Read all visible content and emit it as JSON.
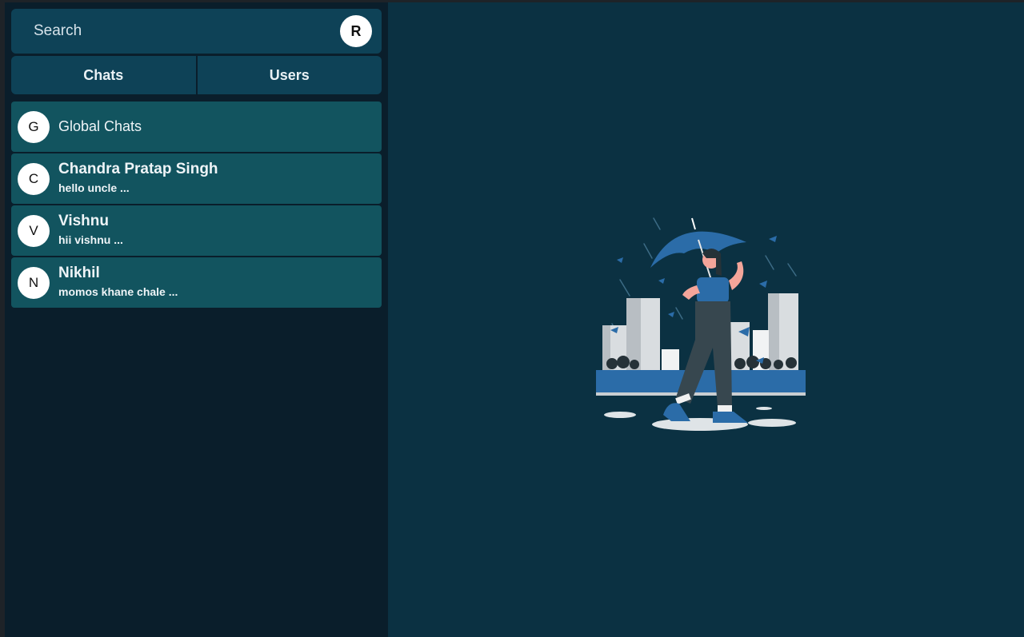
{
  "search": {
    "placeholder": "Search"
  },
  "profile": {
    "initial": "R"
  },
  "tabs": [
    {
      "label": "Chats"
    },
    {
      "label": "Users"
    }
  ],
  "chats": [
    {
      "initial": "G",
      "name": "Global Chats",
      "preview": ""
    },
    {
      "initial": "C",
      "name": "Chandra Pratap Singh",
      "preview": "hello uncle ..."
    },
    {
      "initial": "V",
      "name": "Vishnu",
      "preview": "hii vishnu ..."
    },
    {
      "initial": "N",
      "name": "Nikhil",
      "preview": "momos khane chale ..."
    }
  ],
  "illustration": {
    "icon": "rainy-city-illustration",
    "colors": {
      "accent": "#2b6ca8",
      "sidebar_bg": "#0a1e2b",
      "main_bg": "#0b3142",
      "panel_bg": "#0e4257",
      "chat_item_bg": "#12545f"
    }
  }
}
